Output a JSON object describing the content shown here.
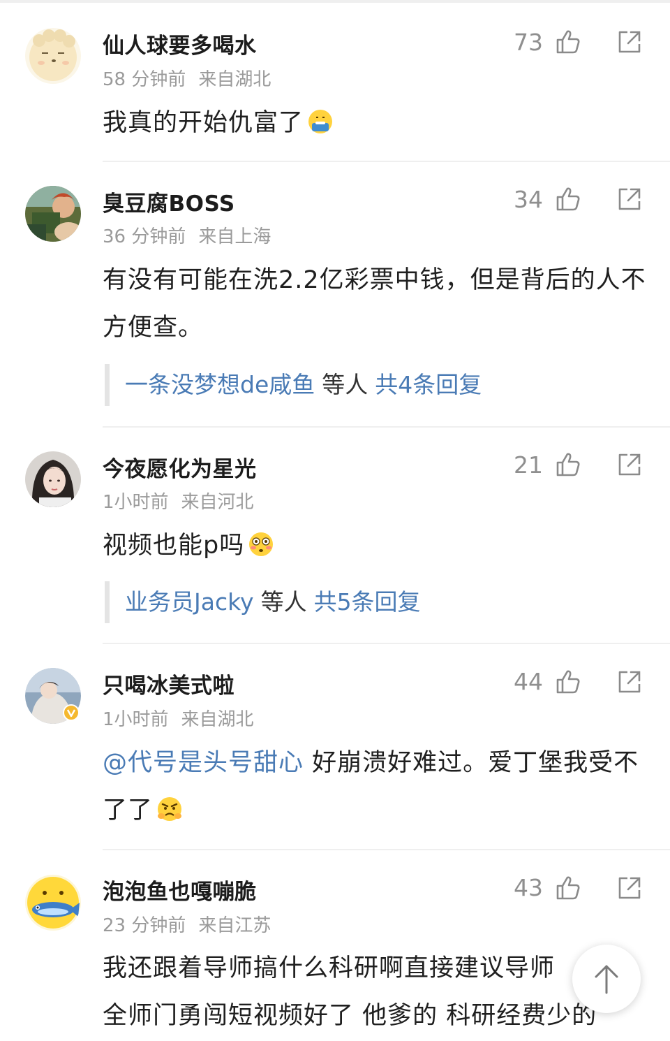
{
  "comments": [
    {
      "username": "仙人球要多喝水",
      "time": "58 分钟前",
      "location": "来自湖北",
      "likes": "73",
      "text": "我真的开始仇富了",
      "emoji": "money-mouth-emoji"
    },
    {
      "username": "臭豆腐BOSS",
      "time": "36 分钟前",
      "location": "来自上海",
      "likes": "34",
      "text": "有没有可能在洗2.2亿彩票中钱，但是背后的人不方便查。",
      "reply_user": "一条没梦想de咸鱼",
      "reply_etc": "等人",
      "reply_total": "共4条回复"
    },
    {
      "username": "今夜愿化为星光",
      "time": "1小时前",
      "location": "来自河北",
      "likes": "21",
      "text": "视频也能p吗",
      "emoji": "flushed-emoji",
      "reply_user": "业务员Jacky",
      "reply_etc": "等人",
      "reply_total": "共5条回复"
    },
    {
      "username": "只喝冰美式啦",
      "time": "1小时前",
      "location": "来自湖北",
      "likes": "44",
      "mention": "@代号是头号甜心",
      "text": " 好崩溃好难过。爱丁堡我受不了了",
      "emoji": "angry-emoji",
      "verified": true
    },
    {
      "username": "泡泡鱼也嘎嘣脆",
      "time": "23 分钟前",
      "location": "来自江苏",
      "likes": "43",
      "text_line1": "我还跟着导师搞什么科研啊直接建议导师",
      "text_line2": "全师门勇闯短视频好了 他爹的 科研经费少的"
    }
  ],
  "icons": {
    "like": "thumbs-up-icon",
    "share": "share-icon",
    "scroll_top": "arrow-up-icon"
  },
  "colors": {
    "link": "#4a7bb5",
    "meta": "#9a9a9a",
    "text": "#1f1f1f"
  }
}
